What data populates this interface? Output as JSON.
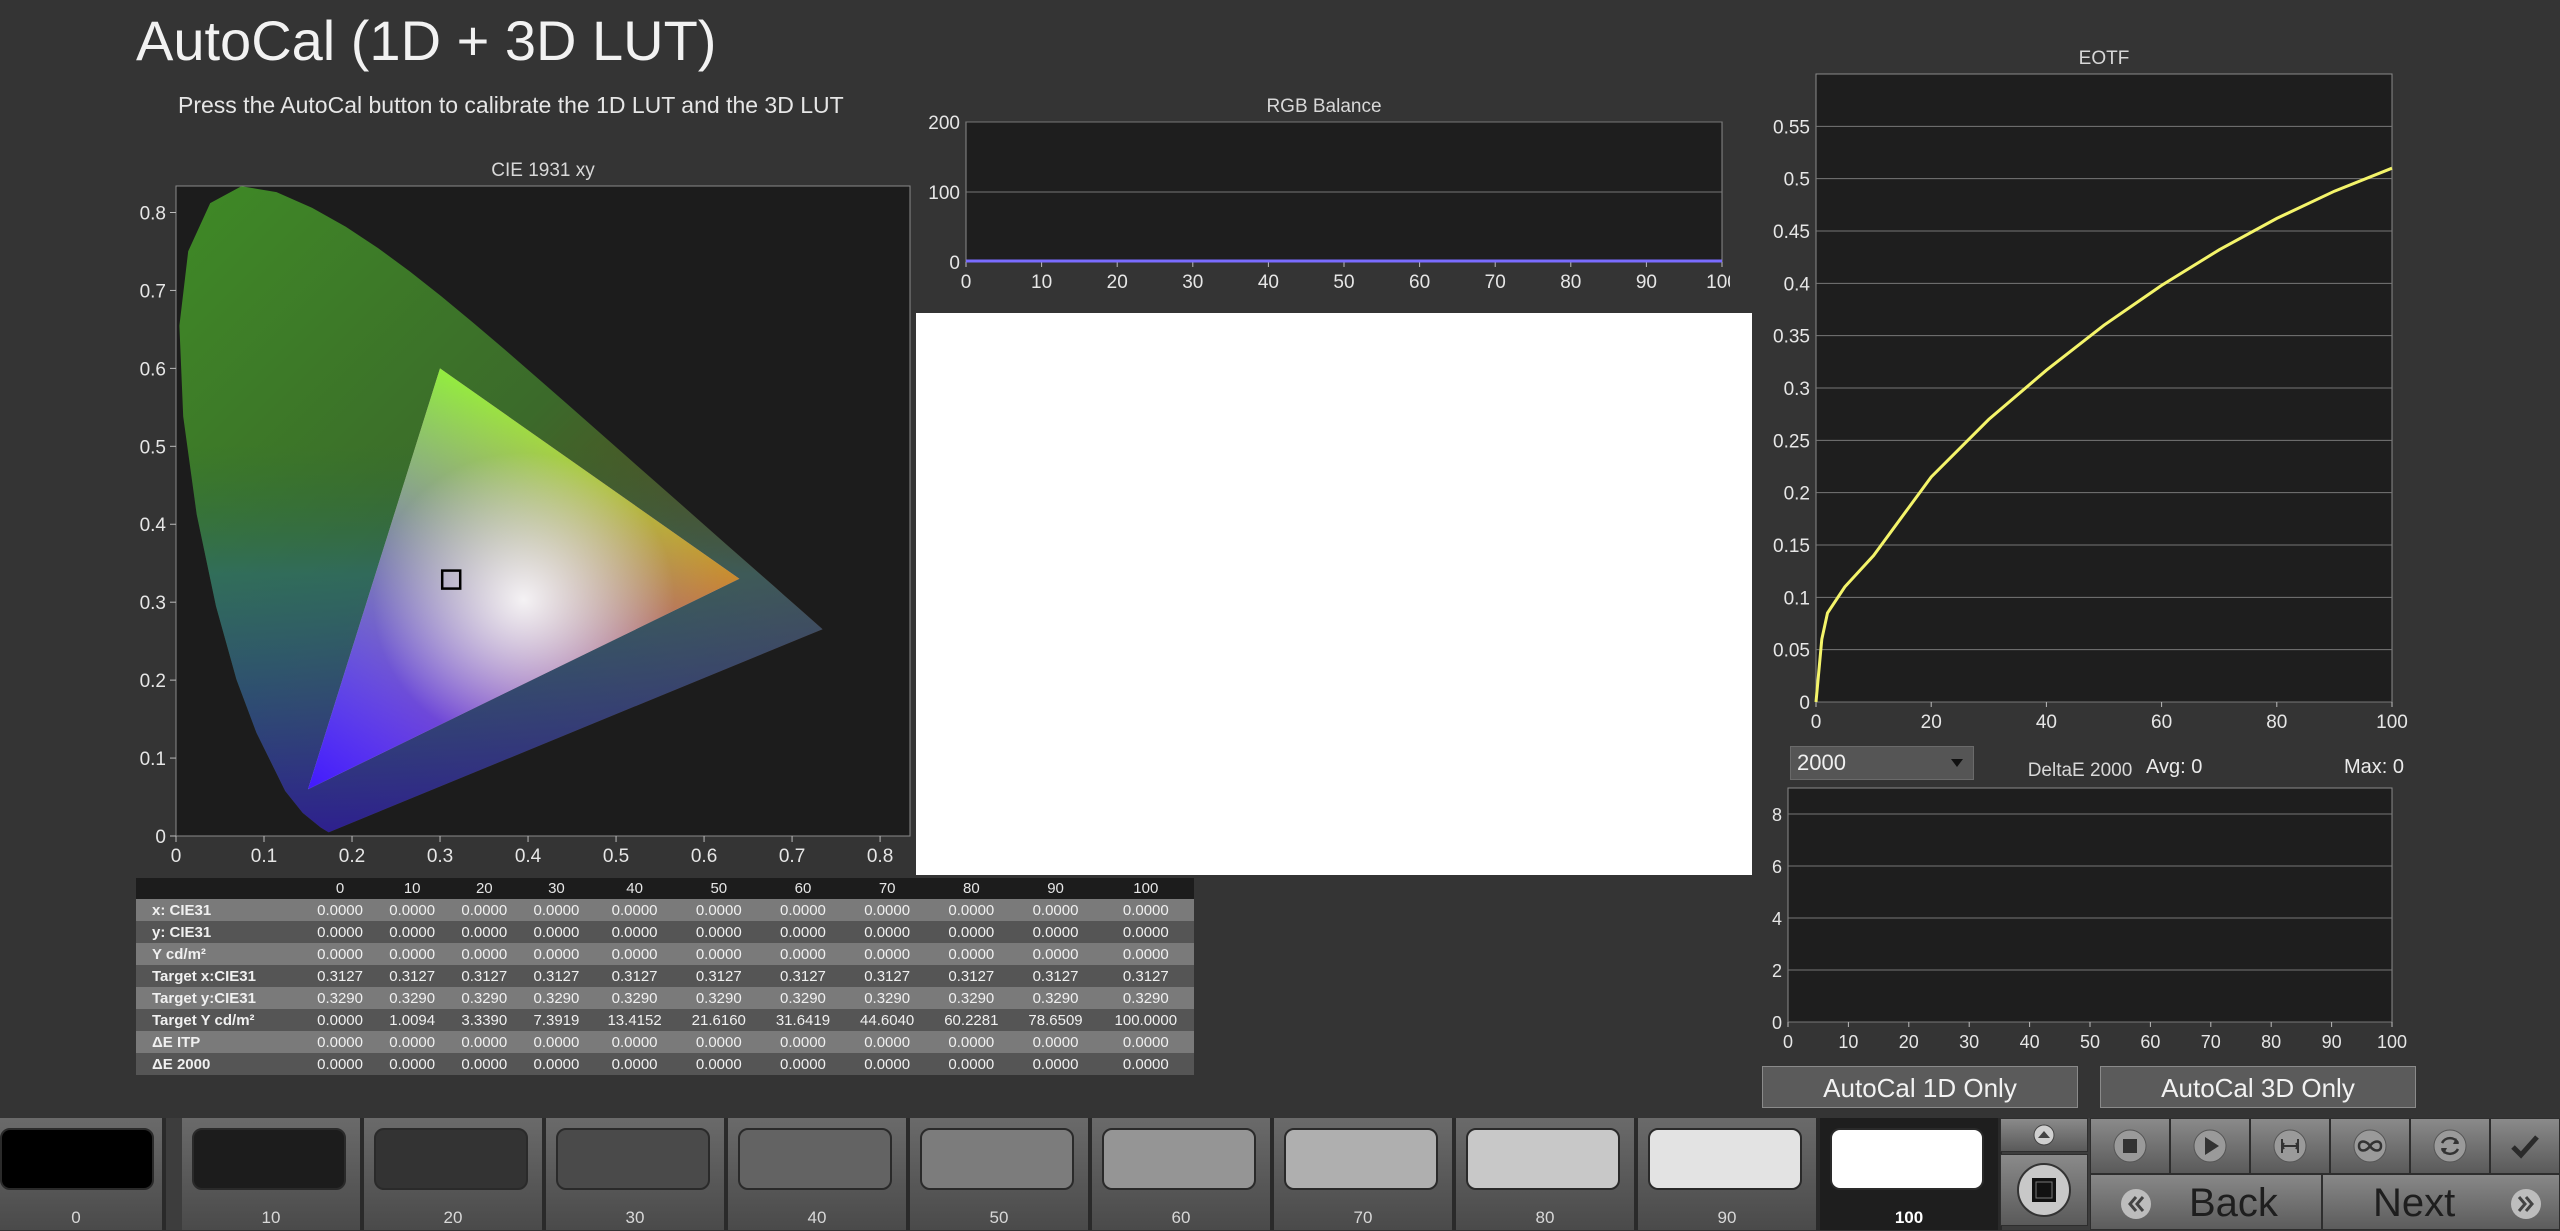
{
  "title": "AutoCal (1D + 3D LUT)",
  "subtitle": "Press the AutoCal button to calibrate the 1D LUT and the 3D LUT",
  "cie": {
    "title": "CIE 1931 xy",
    "x_ticks": [
      "0",
      "0.1",
      "0.2",
      "0.3",
      "0.4",
      "0.5",
      "0.6",
      "0.7",
      "0.8"
    ],
    "y_ticks": [
      "0",
      "0.1",
      "0.2",
      "0.3",
      "0.4",
      "0.5",
      "0.6",
      "0.7",
      "0.8"
    ],
    "white_point": [
      0.3127,
      0.329
    ]
  },
  "rgb_balance": {
    "title": "RGB Balance",
    "x_ticks": [
      "0",
      "10",
      "20",
      "30",
      "40",
      "50",
      "60",
      "70",
      "80",
      "90",
      "100"
    ],
    "y_ticks": [
      "0",
      "100",
      "200"
    ]
  },
  "eotf": {
    "title": "EOTF",
    "x_ticks": [
      "0",
      "20",
      "40",
      "60",
      "80",
      "100"
    ],
    "y_ticks": [
      "0",
      "0.05",
      "0.1",
      "0.15",
      "0.2",
      "0.25",
      "0.3",
      "0.35",
      "0.4",
      "0.45",
      "0.5",
      "0.55"
    ]
  },
  "deltae": {
    "title": "DeltaE 2000",
    "selected": "2000",
    "avg_label": "Avg: 0",
    "max_label": "Max: 0",
    "x_ticks": [
      "0",
      "10",
      "20",
      "30",
      "40",
      "50",
      "60",
      "70",
      "80",
      "90",
      "100"
    ],
    "y_ticks": [
      "0",
      "2",
      "4",
      "6",
      "8"
    ]
  },
  "chart_data": [
    {
      "type": "line",
      "title": "EOTF",
      "x": [
        0,
        1,
        2,
        5,
        10,
        20,
        30,
        40,
        50,
        60,
        70,
        80,
        90,
        100
      ],
      "y": [
        0,
        0.06,
        0.085,
        0.11,
        0.14,
        0.215,
        0.27,
        0.317,
        0.36,
        0.398,
        0.432,
        0.462,
        0.488,
        0.51
      ],
      "xlim": [
        0,
        100
      ],
      "ylim": [
        0,
        0.6
      ],
      "grid": true,
      "color": "#f4f46a"
    },
    {
      "type": "line",
      "title": "RGB Balance",
      "x": [
        0,
        10,
        20,
        30,
        40,
        50,
        60,
        70,
        80,
        90,
        100
      ],
      "y": [
        0,
        0,
        0,
        0,
        0,
        0,
        0,
        0,
        0,
        0,
        0
      ],
      "xlim": [
        0,
        100
      ],
      "ylim": [
        0,
        200
      ],
      "grid": true,
      "color": "#7a6cff"
    },
    {
      "type": "line",
      "title": "DeltaE 2000",
      "x": [
        0,
        10,
        20,
        30,
        40,
        50,
        60,
        70,
        80,
        90,
        100
      ],
      "y": [],
      "xlim": [
        0,
        100
      ],
      "ylim": [
        0,
        9
      ],
      "grid": true
    }
  ],
  "table": {
    "columns": [
      "0",
      "10",
      "20",
      "30",
      "40",
      "50",
      "60",
      "70",
      "80",
      "90",
      "100"
    ],
    "rows": [
      {
        "label": "x: CIE31",
        "values": [
          "0.0000",
          "0.0000",
          "0.0000",
          "0.0000",
          "0.0000",
          "0.0000",
          "0.0000",
          "0.0000",
          "0.0000",
          "0.0000",
          "0.0000"
        ]
      },
      {
        "label": "y: CIE31",
        "values": [
          "0.0000",
          "0.0000",
          "0.0000",
          "0.0000",
          "0.0000",
          "0.0000",
          "0.0000",
          "0.0000",
          "0.0000",
          "0.0000",
          "0.0000"
        ]
      },
      {
        "label": "Y cd/m²",
        "values": [
          "0.0000",
          "0.0000",
          "0.0000",
          "0.0000",
          "0.0000",
          "0.0000",
          "0.0000",
          "0.0000",
          "0.0000",
          "0.0000",
          "0.0000"
        ]
      },
      {
        "label": "Target x:CIE31",
        "values": [
          "0.3127",
          "0.3127",
          "0.3127",
          "0.3127",
          "0.3127",
          "0.3127",
          "0.3127",
          "0.3127",
          "0.3127",
          "0.3127",
          "0.3127"
        ]
      },
      {
        "label": "Target y:CIE31",
        "values": [
          "0.3290",
          "0.3290",
          "0.3290",
          "0.3290",
          "0.3290",
          "0.3290",
          "0.3290",
          "0.3290",
          "0.3290",
          "0.3290",
          "0.3290"
        ]
      },
      {
        "label": "Target Y cd/m²",
        "values": [
          "0.0000",
          "1.0094",
          "3.3390",
          "7.3919",
          "13.4152",
          "21.6160",
          "31.6419",
          "44.6040",
          "60.2281",
          "78.6509",
          "100.0000"
        ]
      },
      {
        "label": "ΔE ITP",
        "values": [
          "0.0000",
          "0.0000",
          "0.0000",
          "0.0000",
          "0.0000",
          "0.0000",
          "0.0000",
          "0.0000",
          "0.0000",
          "0.0000",
          "0.0000"
        ]
      },
      {
        "label": "ΔE 2000",
        "values": [
          "0.0000",
          "0.0000",
          "0.0000",
          "0.0000",
          "0.0000",
          "0.0000",
          "0.0000",
          "0.0000",
          "0.0000",
          "0.0000",
          "0.0000"
        ]
      }
    ]
  },
  "buttons": {
    "autocal_1d": "AutoCal 1D Only",
    "autocal_3d": "AutoCal 3D Only",
    "back": "Back",
    "next": "Next"
  },
  "swatches": [
    {
      "label": "0",
      "color": "#000000"
    },
    {
      "label": "10",
      "color": "#1c1c1c"
    },
    {
      "label": "20",
      "color": "#333333"
    },
    {
      "label": "30",
      "color": "#4a4a4a"
    },
    {
      "label": "40",
      "color": "#636363"
    },
    {
      "label": "50",
      "color": "#7c7c7c"
    },
    {
      "label": "60",
      "color": "#959595"
    },
    {
      "label": "70",
      "color": "#afafaf"
    },
    {
      "label": "80",
      "color": "#c8c8c8"
    },
    {
      "label": "90",
      "color": "#e3e3e3"
    },
    {
      "label": "100",
      "color": "#ffffff"
    }
  ],
  "active_swatch": "100",
  "icons": {
    "stop": "stop-icon",
    "play": "play-icon",
    "step": "step-icon",
    "loop": "loop-icon",
    "refresh": "refresh-icon",
    "check": "check-icon",
    "up": "chevron-up-icon",
    "pattern": "pattern-window-icon"
  }
}
